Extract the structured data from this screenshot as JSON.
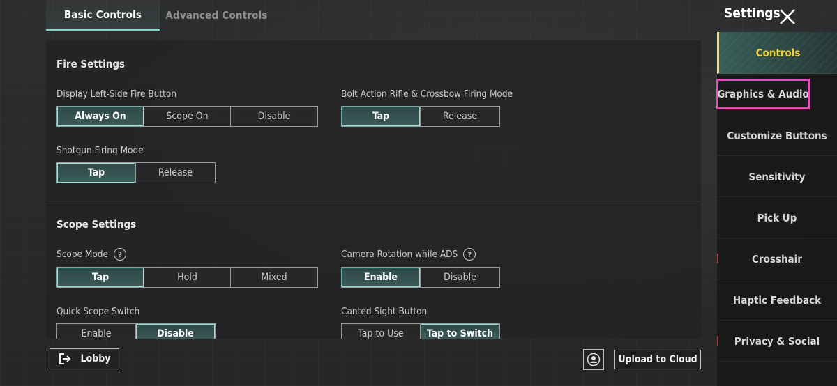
{
  "top_tabs": [
    {
      "label": "Basic Controls",
      "active": true
    },
    {
      "label": "Advanced Controls",
      "active": false
    }
  ],
  "fire_settings": {
    "title": "Fire Settings",
    "left_fire_button": {
      "label": "Display Left-Side Fire Button",
      "options": [
        "Always On",
        "Scope On",
        "Disable"
      ],
      "selected": "Always On"
    },
    "bolt_action": {
      "label": "Bolt Action Rifle & Crossbow Firing Mode",
      "options": [
        "Tap",
        "Release"
      ],
      "selected": "Tap"
    },
    "shotgun": {
      "label": "Shotgun Firing Mode",
      "options": [
        "Tap",
        "Release"
      ],
      "selected": "Tap"
    }
  },
  "scope_settings": {
    "title": "Scope Settings",
    "scope_mode": {
      "label": "Scope Mode",
      "help_icon": "question-circle",
      "options": [
        "Tap",
        "Hold",
        "Mixed"
      ],
      "selected": "Tap"
    },
    "camera_rotation": {
      "label": "Camera Rotation while ADS",
      "help_icon": "question-circle",
      "options": [
        "Enable",
        "Disable"
      ],
      "selected": "Enable"
    },
    "quick_scope": {
      "label": "Quick Scope Switch",
      "options": [
        "Enable",
        "Disable"
      ],
      "selected": "Disable"
    },
    "canted_sight": {
      "label": "Canted Sight Button",
      "options": [
        "Tap to Use",
        "Tap to Switch"
      ],
      "selected": "Tap to Switch"
    }
  },
  "bottom_bar": {
    "lobby_label": "Lobby",
    "lobby_icon": "exit-icon",
    "cloud_icon": "cloud-user-icon",
    "upload_label": "Upload to Cloud"
  },
  "sidebar": {
    "title": "Settings",
    "close_icon": "close-x",
    "items": [
      {
        "label": "Controls",
        "active": true
      },
      {
        "label": "Graphics & Audio",
        "active": false,
        "highlighted": true
      },
      {
        "label": "Customize Buttons",
        "active": false
      },
      {
        "label": "Sensitivity",
        "active": false
      },
      {
        "label": "Pick Up",
        "active": false
      },
      {
        "label": "Crosshair",
        "active": false
      },
      {
        "label": "Haptic Feedback",
        "active": false
      },
      {
        "label": "Privacy & Social",
        "active": false
      }
    ]
  },
  "colors": {
    "accent_teal": "#8fe3d8",
    "active_yellow": "#f3d33b",
    "highlight_pink": "#e64fb7"
  }
}
